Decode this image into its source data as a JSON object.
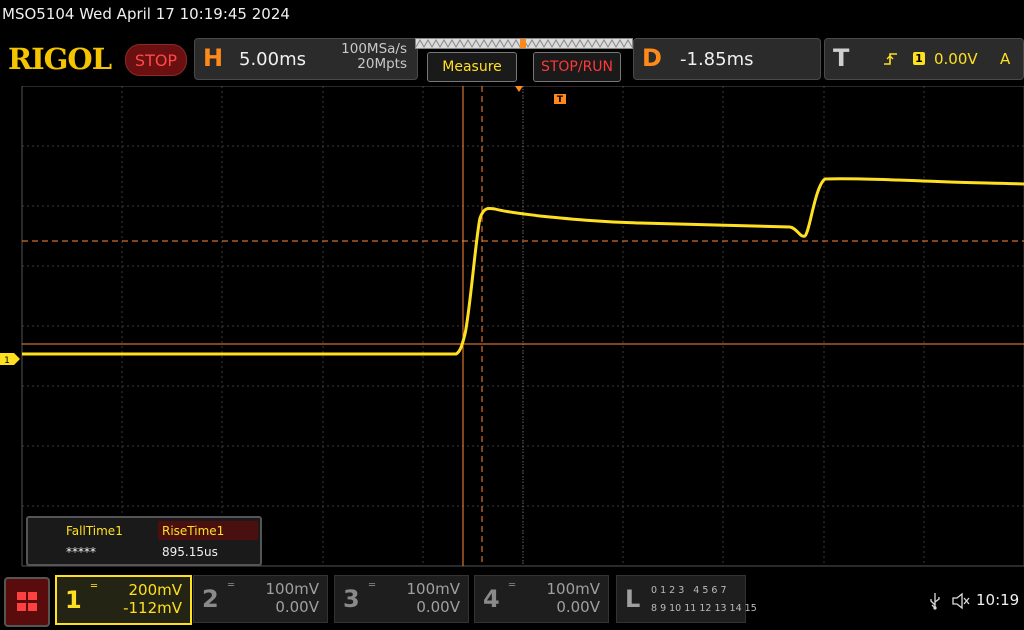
{
  "header": {
    "model_datetime": "MSO5104  Wed April 17 10:19:45 2024",
    "logo": "RIGOL",
    "run_state": "STOP"
  },
  "horizontal": {
    "letter": "H",
    "timebase": "5.00ms",
    "sample_rate": "100MSa/s",
    "memory_depth": "20Mpts"
  },
  "buttons": {
    "measure": "Measure",
    "stop_run": "STOP/RUN"
  },
  "delay": {
    "letter": "D",
    "value": "-1.85ms"
  },
  "trigger": {
    "letter": "T",
    "channel": "1",
    "level": "0.00V",
    "mode": "A",
    "marker": "T"
  },
  "channel_marker": "1",
  "measurements": {
    "fall_label": "FallTime1",
    "fall_value": "*****",
    "rise_label": "RiseTime1",
    "rise_value": "895.15us"
  },
  "channels": [
    {
      "number": "1",
      "scale": "200mV",
      "offset": "-112mV",
      "color": "#ffe020"
    },
    {
      "number": "2",
      "scale": "100mV",
      "offset": "0.00V",
      "color": "#8a8a8a"
    },
    {
      "number": "3",
      "scale": "100mV",
      "offset": "0.00V",
      "color": "#8a8a8a"
    },
    {
      "number": "4",
      "scale": "100mV",
      "offset": "0.00V",
      "color": "#8a8a8a"
    }
  ],
  "logic": {
    "letter": "L",
    "row1": "0 1 2 3   4 5 6 7",
    "row2": "8 9 10 11 12 13 14 15"
  },
  "status": {
    "time": "10:19"
  },
  "colors": {
    "trace": "#ffe020",
    "cursor": "#ff8a3a",
    "accent": "#ff8a1a"
  }
}
